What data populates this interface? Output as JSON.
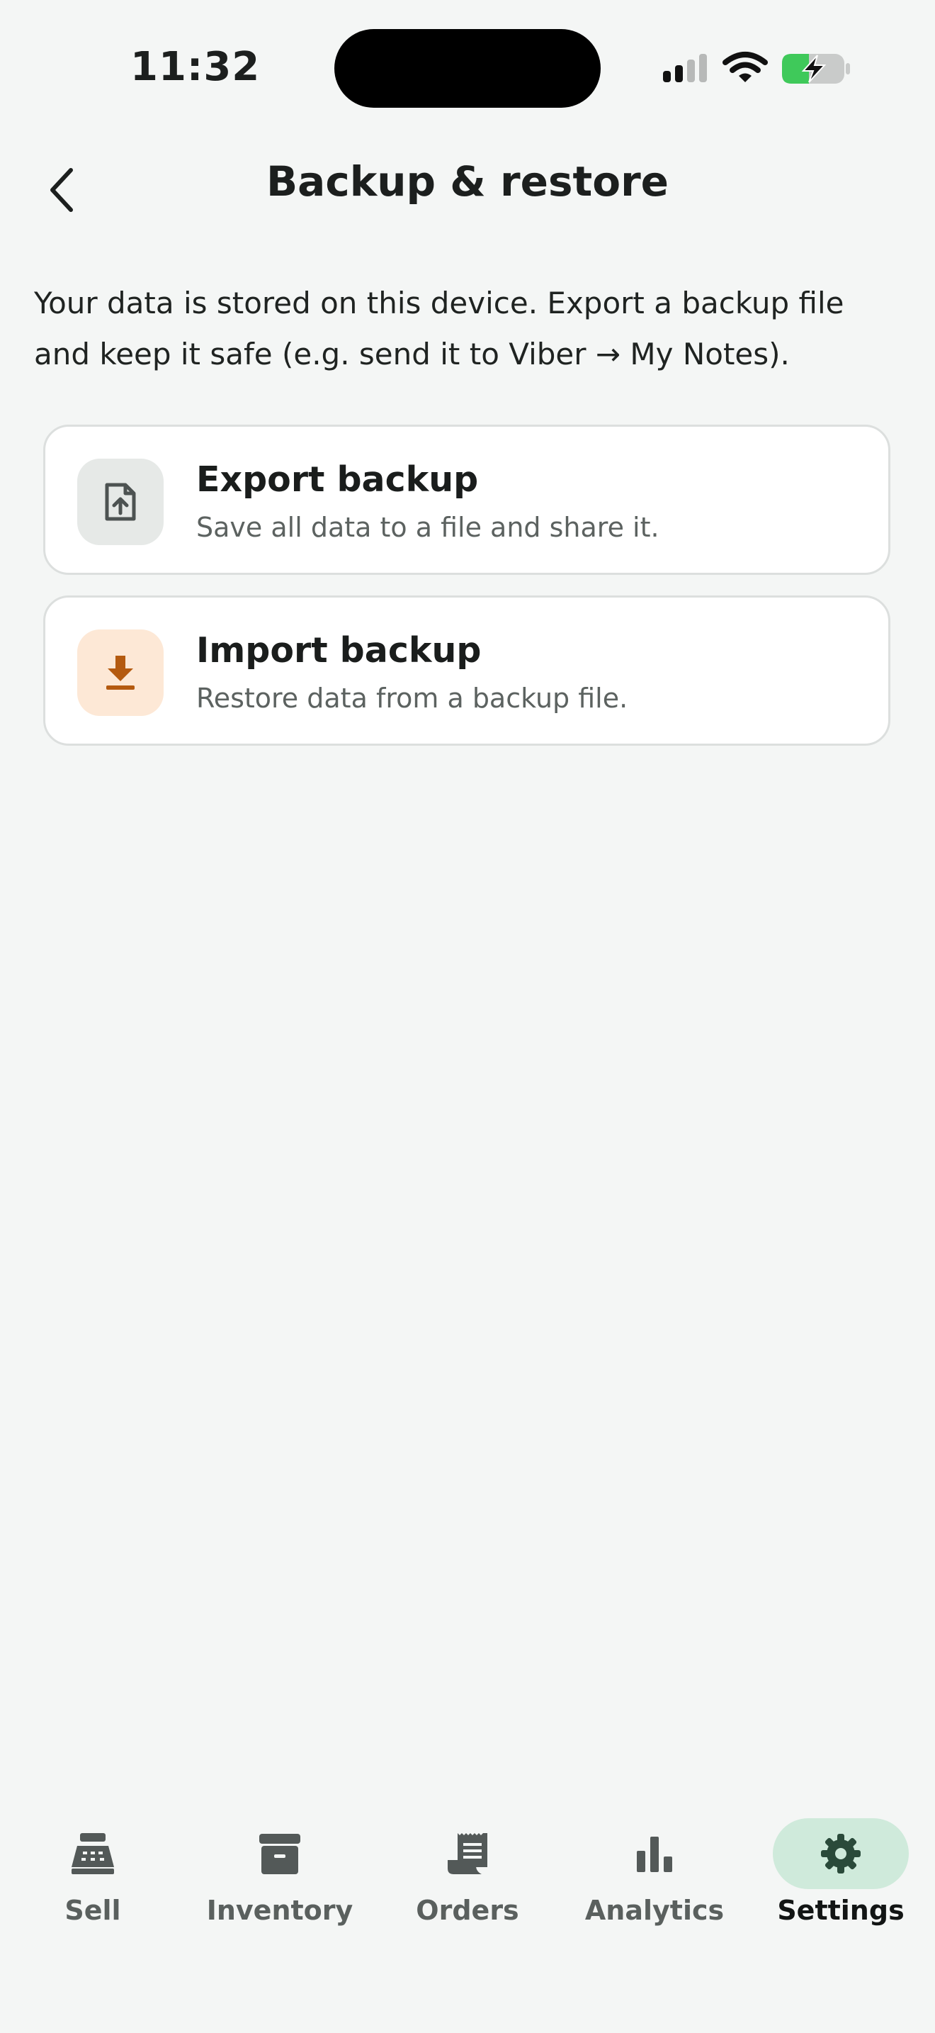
{
  "status_bar": {
    "time": "11:32",
    "battery_color": "#3fc95a"
  },
  "header": {
    "back_icon": "chevron-left-icon",
    "title": "Backup & restore"
  },
  "intro_text": "Your data is stored on this device. Export a backup file and keep it safe (e.g. send it to Viber → My Notes).",
  "actions": [
    {
      "title": "Export backup",
      "subtitle": "Save all data to a file and share it.",
      "icon": "file-upload-icon",
      "tile_color": "#e6e9e7",
      "icon_color": "#4d5352"
    },
    {
      "title": "Import backup",
      "subtitle": "Restore data from a backup file.",
      "icon": "download-icon",
      "tile_color": "#fde8d6",
      "icon_color": "#b45a10"
    }
  ],
  "tabbar": {
    "active": "Settings",
    "active_color": "#cfeadb",
    "tabs": [
      {
        "label": "Sell",
        "icon": "cash-register-icon"
      },
      {
        "label": "Inventory",
        "icon": "archive-box-icon"
      },
      {
        "label": "Orders",
        "icon": "receipt-icon"
      },
      {
        "label": "Analytics",
        "icon": "bar-chart-icon"
      },
      {
        "label": "Settings",
        "icon": "gear-icon"
      }
    ]
  }
}
